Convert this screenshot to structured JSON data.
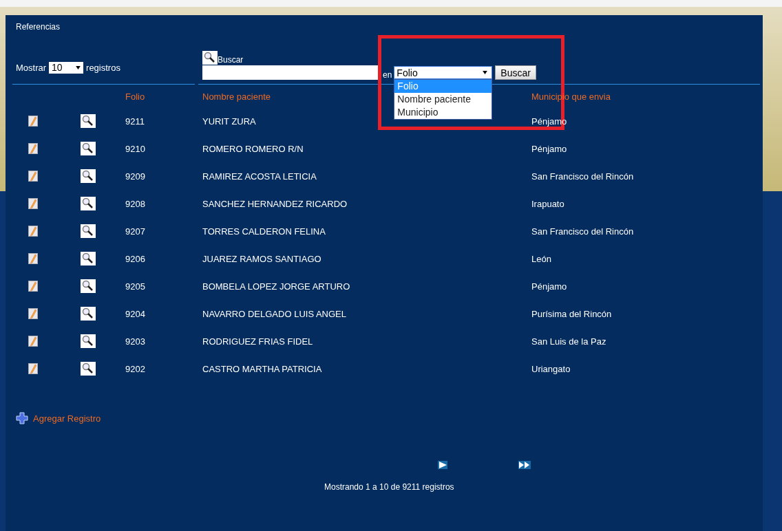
{
  "panel": {
    "title": "Referencias"
  },
  "length_control": {
    "label_before": "Mostrar",
    "value": "10",
    "label_after": "registros"
  },
  "search": {
    "label": "Buscar",
    "in_label": "en",
    "field_select": {
      "value": "Folio",
      "expanded": true,
      "options": [
        {
          "label": "Folio",
          "selected": true
        },
        {
          "label": "Nombre paciente",
          "selected": false
        },
        {
          "label": "Municipio",
          "selected": false
        }
      ]
    },
    "button": "Buscar"
  },
  "table": {
    "columns": [
      "Folio",
      "Nombre paciente",
      "Municipio que envia"
    ],
    "rows": [
      {
        "folio": "9211",
        "name": "YURIT ZURA",
        "municipio": "Pénjamo"
      },
      {
        "folio": "9210",
        "name": "ROMERO ROMERO R/N",
        "municipio": "Pénjamo"
      },
      {
        "folio": "9209",
        "name": "RAMIREZ ACOSTA LETICIA",
        "municipio": "San Francisco del Rincón"
      },
      {
        "folio": "9208",
        "name": "SANCHEZ HERNANDEZ RICARDO",
        "municipio": "Irapuato"
      },
      {
        "folio": "9207",
        "name": "TORRES CALDERON FELINA",
        "municipio": "San Francisco del Rincón"
      },
      {
        "folio": "9206",
        "name": "JUAREZ RAMOS SANTIAGO",
        "municipio": "León"
      },
      {
        "folio": "9205",
        "name": "BOMBELA LOPEZ JORGE ARTURO",
        "municipio": "Pénjamo"
      },
      {
        "folio": "9204",
        "name": "NAVARRO DELGADO LUIS ANGEL",
        "municipio": "Purísima del Rincón"
      },
      {
        "folio": "9203",
        "name": "RODRIGUEZ FRIAS FIDEL",
        "municipio": "San Luis de la Paz"
      },
      {
        "folio": "9202",
        "name": "CASTRO MARTHA PATRICIA",
        "municipio": "Uriangato"
      }
    ]
  },
  "add_link": "Agregar Registro",
  "pagination": {
    "info": "Mostrando 1 a 10 de 9211 registros"
  },
  "highlight_frame": true
}
